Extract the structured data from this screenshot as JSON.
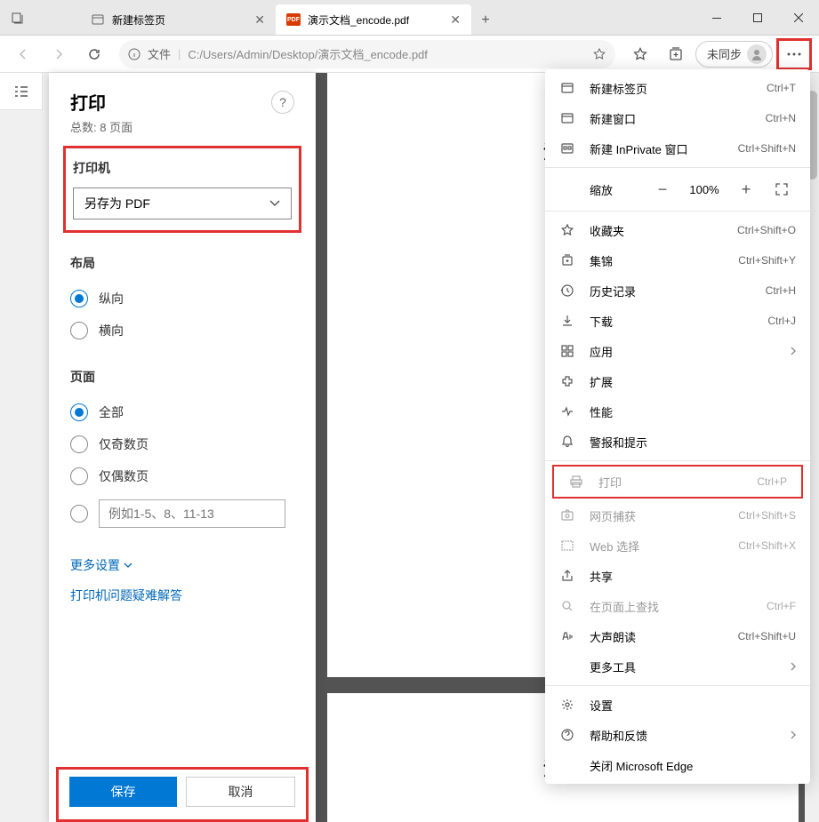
{
  "titleBar": {
    "tabs": [
      {
        "label": "新建标签页",
        "active": false
      },
      {
        "label": "演示文档_encode.pdf",
        "active": true
      }
    ]
  },
  "addressBar": {
    "urlPrefix": "文件",
    "urlPath": "C:/Users/Admin/Desktop/演示文档_encode.pdf",
    "syncLabel": "未同步"
  },
  "printPanel": {
    "title": "打印",
    "subtitle": "总数: 8 页面",
    "printerLabel": "打印机",
    "printerValue": "另存为 PDF",
    "layoutLabel": "布局",
    "layoutOptions": {
      "portrait": "纵向",
      "landscape": "横向"
    },
    "pagesLabel": "页面",
    "pagesOptions": {
      "all": "全部",
      "odd": "仅奇数页",
      "even": "仅偶数页"
    },
    "pagesPlaceholder": "例如1-5、8、11-13",
    "moreSettings": "更多设置",
    "troubleshoot": "打印机问题疑难解答",
    "saveBtn": "保存",
    "cancelBtn": "取消"
  },
  "preview": {
    "page1Title": "演示",
    "page2Title": "演示"
  },
  "menu": {
    "items": [
      {
        "icon": "tab",
        "label": "新建标签页",
        "shortcut": "Ctrl+T"
      },
      {
        "icon": "window",
        "label": "新建窗口",
        "shortcut": "Ctrl+N"
      },
      {
        "icon": "inprivate",
        "label": "新建 InPrivate 窗口",
        "shortcut": "Ctrl+Shift+N"
      }
    ],
    "zoom": {
      "label": "缩放",
      "value": "100%"
    },
    "items2": [
      {
        "icon": "star",
        "label": "收藏夹",
        "shortcut": "Ctrl+Shift+O"
      },
      {
        "icon": "collections",
        "label": "集锦",
        "shortcut": "Ctrl+Shift+Y"
      },
      {
        "icon": "history",
        "label": "历史记录",
        "shortcut": "Ctrl+H"
      },
      {
        "icon": "download",
        "label": "下载",
        "shortcut": "Ctrl+J"
      },
      {
        "icon": "apps",
        "label": "应用",
        "chevron": true
      },
      {
        "icon": "extensions",
        "label": "扩展"
      },
      {
        "icon": "performance",
        "label": "性能"
      },
      {
        "icon": "bell",
        "label": "警报和提示"
      }
    ],
    "items3": [
      {
        "icon": "print",
        "label": "打印",
        "shortcut": "Ctrl+P",
        "disabled": true,
        "highlight": true
      },
      {
        "icon": "capture",
        "label": "网页捕获",
        "shortcut": "Ctrl+Shift+S",
        "disabled": true
      },
      {
        "icon": "select",
        "label": "Web 选择",
        "shortcut": "Ctrl+Shift+X",
        "disabled": true
      },
      {
        "icon": "share",
        "label": "共享"
      },
      {
        "icon": "find",
        "label": "在页面上查找",
        "shortcut": "Ctrl+F",
        "disabled": true
      },
      {
        "icon": "read",
        "label": "大声朗读",
        "shortcut": "Ctrl+Shift+U"
      },
      {
        "icon": "",
        "label": "更多工具",
        "chevron": true
      }
    ],
    "items4": [
      {
        "icon": "settings",
        "label": "设置"
      },
      {
        "icon": "help",
        "label": "帮助和反馈",
        "chevron": true
      },
      {
        "icon": "",
        "label": "关闭 Microsoft Edge"
      }
    ]
  }
}
